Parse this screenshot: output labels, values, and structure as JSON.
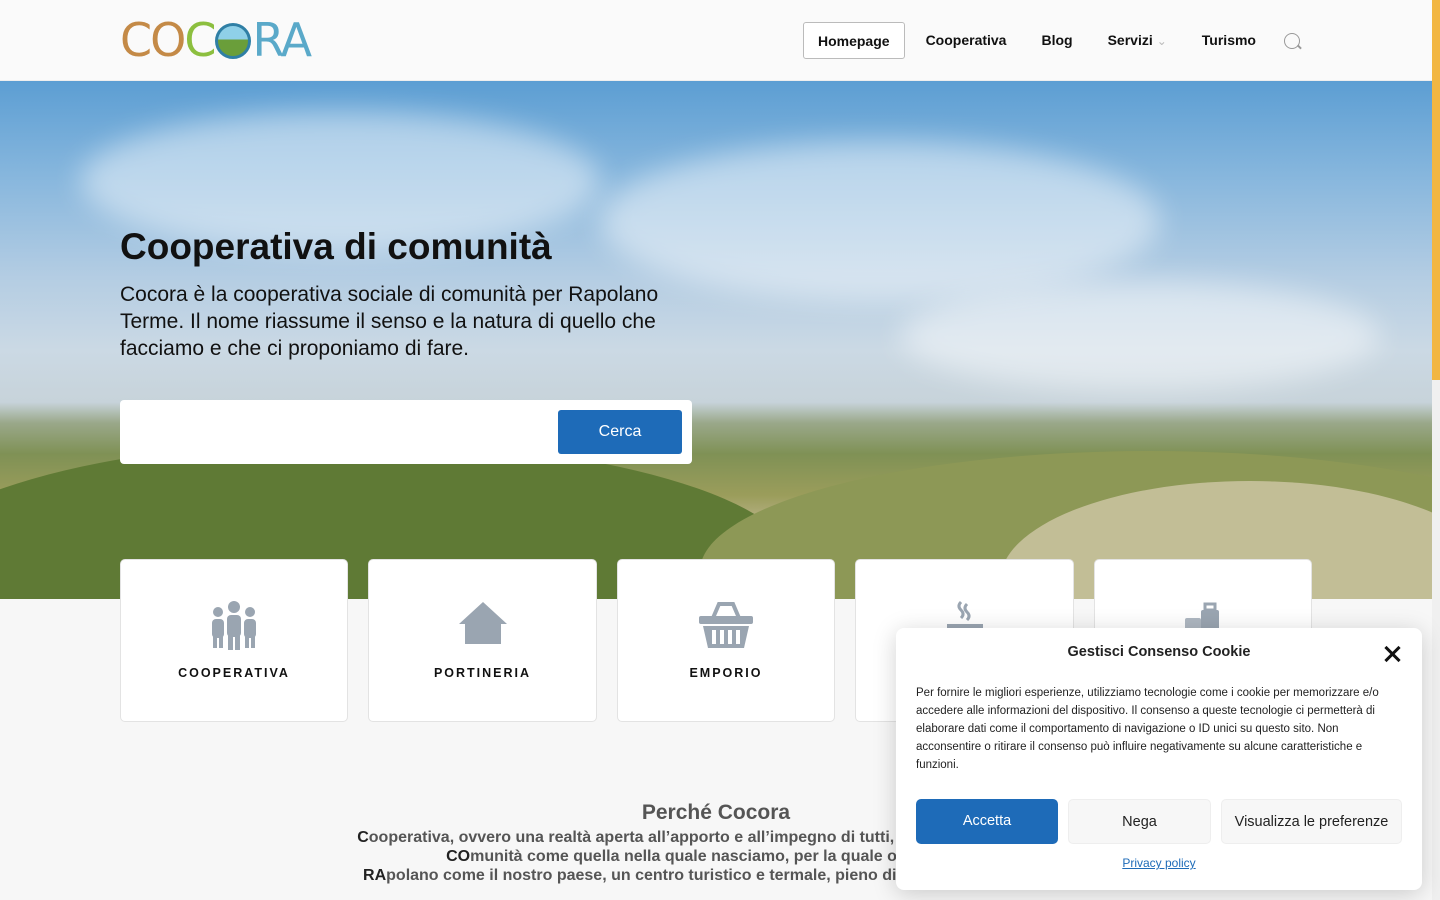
{
  "header": {
    "logo_alt": "COCORA",
    "nav": [
      {
        "label": "Homepage",
        "active": true
      },
      {
        "label": "Cooperativa"
      },
      {
        "label": "Blog"
      },
      {
        "label": "Servizi",
        "has_caret": true
      },
      {
        "label": "Turismo"
      }
    ],
    "search_icon": "search-icon"
  },
  "hero": {
    "title": "Cooperativa di comunità",
    "subtitle": "Cocora è la cooperativa sociale di comunità per Rapolano Terme. Il nome riassume il senso e la natura di quello che facciamo e che ci proponiamo di fare.",
    "search_placeholder": "",
    "search_button": "Cerca"
  },
  "cards": [
    {
      "label": "COOPERATIVA",
      "icon": "people-icon"
    },
    {
      "label": "PORTINERIA",
      "icon": "house-icon"
    },
    {
      "label": "EMPORIO",
      "icon": "basket-icon"
    },
    {
      "label": "",
      "icon": "coffee-icon"
    },
    {
      "label": "",
      "icon": "luggage-icon"
    }
  ],
  "perche": {
    "title": "Perché Cocora",
    "line1_bold": "C",
    "line1": "ooperativa, ovvero una realtà aperta all’apporto e all’impegno di tutti, capace di privilegiare c",
    "line2_bold": "CO",
    "line2": "munità come quella nella quale nasciamo, per la quale operiamo e c",
    "line3_bold": "RA",
    "line3": "polano come il nostro paese, un centro turistico e termale, pieno di storia e chiamato ad a"
  },
  "cookie": {
    "title": "Gestisci Consenso Cookie",
    "body": "Per fornire le migliori esperienze, utilizziamo tecnologie come i cookie per memorizzare e/o accedere alle informazioni del dispositivo. Il consenso a queste tecnologie ci permetterà di elaborare dati come il comportamento di navigazione o ID unici su questo sito. Non acconsentire o ritirare il consenso può influire negativamente su alcune caratteristiche e funzioni.",
    "accept": "Accetta",
    "deny": "Nega",
    "prefs": "Visualizza le preferenze",
    "privacy": "Privacy policy"
  },
  "colors": {
    "accent": "#1e6bb8",
    "scroll_thumb": "#f2b642",
    "icon_gray": "#9aa5b1"
  }
}
